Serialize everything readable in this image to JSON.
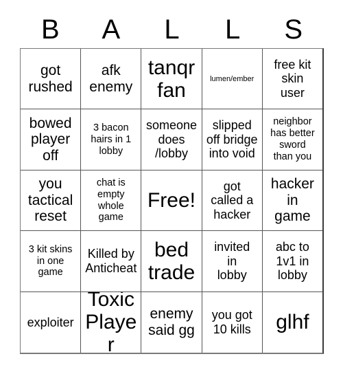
{
  "card": {
    "header_letters": [
      "B",
      "A",
      "L",
      "L",
      "S"
    ],
    "rows": [
      [
        {
          "text": "got\nrushed",
          "size": "fs-lg"
        },
        {
          "text": "afk\nenemy",
          "size": "fs-lg"
        },
        {
          "text": "tanqr\nfan",
          "size": "fs-xl"
        },
        {
          "text": "lumen/ember",
          "size": "fs-xs"
        },
        {
          "text": "free kit\nskin\nuser",
          "size": "fs-md"
        }
      ],
      [
        {
          "text": "bowed\nplayer\noff",
          "size": "fs-lg"
        },
        {
          "text": "3 bacon\nhairs in 1\nlobby",
          "size": "fs-sm"
        },
        {
          "text": "someone\ndoes\n/lobby",
          "size": "fs-md"
        },
        {
          "text": "slipped\noff bridge\ninto void",
          "size": "fs-md"
        },
        {
          "text": "neighbor\nhas better\nsword\nthan you",
          "size": "fs-sm"
        }
      ],
      [
        {
          "text": "you\ntactical\nreset",
          "size": "fs-lg"
        },
        {
          "text": "chat is\nempty\nwhole\ngame",
          "size": "fs-sm"
        },
        {
          "text": "Free!",
          "size": "fs-xl"
        },
        {
          "text": "got\ncalled a\nhacker",
          "size": "fs-md"
        },
        {
          "text": "hacker\nin\ngame",
          "size": "fs-lg"
        }
      ],
      [
        {
          "text": "3 kit skins\nin one\ngame",
          "size": "fs-sm"
        },
        {
          "text": "Killed by\nAnticheat",
          "size": "fs-md"
        },
        {
          "text": "bed\ntrade",
          "size": "fs-xl"
        },
        {
          "text": "invited\nin\nlobby",
          "size": "fs-md"
        },
        {
          "text": "abc to\n1v1 in\nlobby",
          "size": "fs-md"
        }
      ],
      [
        {
          "text": "exploiter",
          "size": "fs-md"
        },
        {
          "text": "Toxic\nPlayer",
          "size": "fs-xl"
        },
        {
          "text": "enemy\nsaid gg",
          "size": "fs-lg"
        },
        {
          "text": "you got\n10 kills",
          "size": "fs-md"
        },
        {
          "text": "glhf",
          "size": "fs-xl"
        }
      ]
    ]
  }
}
